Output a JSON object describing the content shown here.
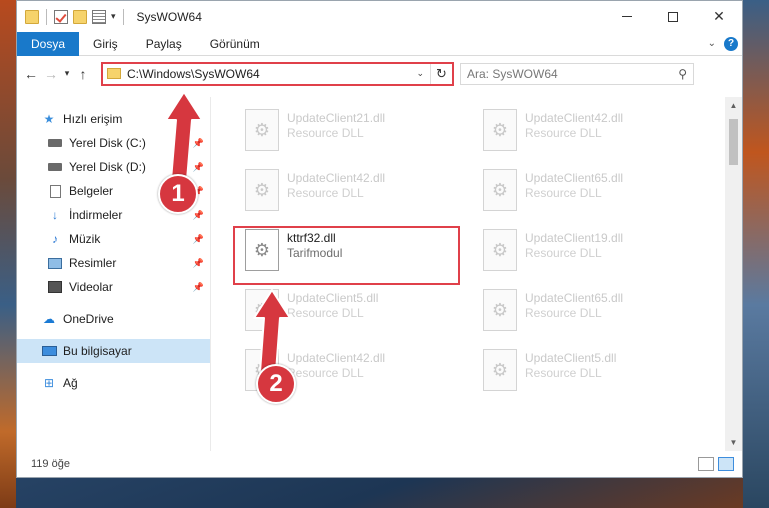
{
  "window": {
    "title": "SysWOW64"
  },
  "ribbon": {
    "tabs": [
      {
        "label": "Dosya"
      },
      {
        "label": "Giriş"
      },
      {
        "label": "Paylaş"
      },
      {
        "label": "Görünüm"
      }
    ]
  },
  "navbar": {
    "address": "C:\\Windows\\SysWOW64",
    "search_placeholder": "Ara: SysWOW64"
  },
  "sidebar": {
    "quick_access": "Hızlı erişim",
    "items": [
      {
        "label": "Yerel Disk (C:)",
        "icon": "drive-icon"
      },
      {
        "label": "Yerel Disk (D:)",
        "icon": "drive-icon"
      },
      {
        "label": "Belgeler",
        "icon": "documents-icon"
      },
      {
        "label": "İndirmeler",
        "icon": "download-icon"
      },
      {
        "label": "Müzik",
        "icon": "music-icon"
      },
      {
        "label": "Resimler",
        "icon": "pictures-icon"
      },
      {
        "label": "Videolar",
        "icon": "videos-icon"
      }
    ],
    "onedrive": "OneDrive",
    "this_pc": "Bu bilgisayar",
    "network": "Ağ"
  },
  "files": [
    {
      "name": "UpdateClient21.dll",
      "desc": "Resource DLL"
    },
    {
      "name": "UpdateClient42.dll",
      "desc": "Resource DLL"
    },
    {
      "name": "UpdateClient42.dll",
      "desc": "Resource DLL"
    },
    {
      "name": "UpdateClient65.dll",
      "desc": "Resource DLL"
    },
    {
      "name": "kttrf32.dll",
      "desc": "Tarifmodul"
    },
    {
      "name": "UpdateClient19.dll",
      "desc": "Resource DLL"
    },
    {
      "name": "UpdateClient5.dll",
      "desc": "Resource DLL"
    },
    {
      "name": "UpdateClient65.dll",
      "desc": "Resource DLL"
    },
    {
      "name": "UpdateClient42.dll",
      "desc": "Resource DLL"
    },
    {
      "name": "UpdateClient5.dll",
      "desc": "Resource DLL"
    }
  ],
  "status": {
    "count": "119 öğe"
  },
  "annotations": {
    "step1": "1",
    "step2": "2",
    "color": "#d6373f"
  }
}
